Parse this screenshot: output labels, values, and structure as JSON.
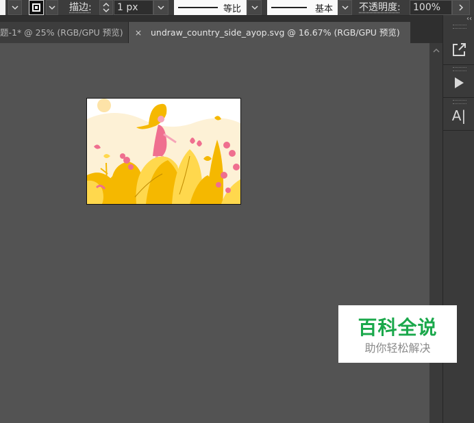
{
  "toolbar": {
    "stroke_label": "描边:",
    "stroke_weight": "1 px",
    "profile_label": "等比",
    "brush_label": "基本",
    "opacity_label": "不透明度:",
    "opacity_value": "100%"
  },
  "tabs": [
    {
      "label": "题-1* @ 25% (RGB/GPU 预览)",
      "active": false
    },
    {
      "label": "undraw_country_side_ayop.svg @ 16.67% (RGB/GPU 预览)",
      "active": true
    }
  ],
  "icons": {
    "close": "×",
    "chevron": "⌄",
    "collapse": "‹‹",
    "play": "▶",
    "type": "A|"
  },
  "artwork_colors": {
    "yellow": "#f5b800",
    "light_yellow": "#ffd84d",
    "pink": "#ef6f8f",
    "skin": "#f6a4b8",
    "sun": "#fde3a8",
    "haze": "#fdf1d6"
  },
  "watermark": {
    "brand": "百科全说",
    "slogan": "助你轻松解决",
    "brand_color": "#1aa84b"
  }
}
